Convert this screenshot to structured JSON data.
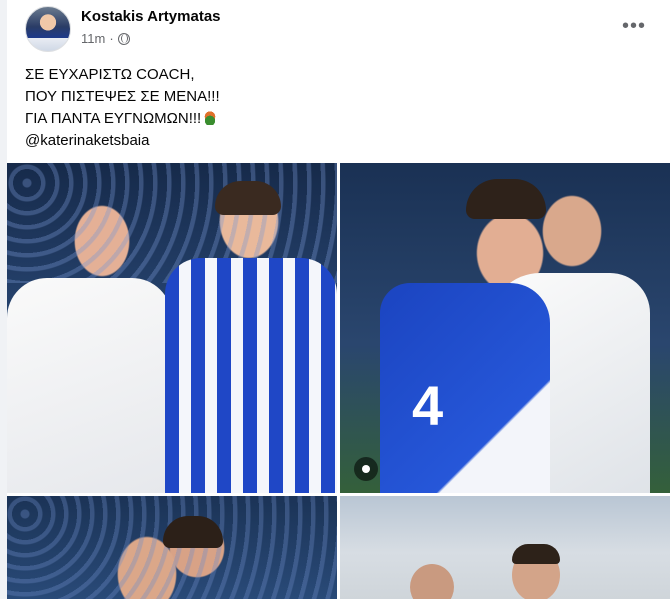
{
  "post": {
    "author": "Kostakis Artymatas",
    "time": "11m",
    "separator": "·",
    "audience_icon": "globe-icon",
    "more_label": "•••",
    "text_lines": [
      "ΣΕ ΕΥΧΑΡΙΣΤΩ COACH,",
      "ΠΟΥ ΠΙΣΤΕΨΕΣ ΣΕ ΜΕΝΑ!!!",
      "ΓΙΑ ΠΑΝΤΑ ΕΥΓΝΩΜΩΝ!!!",
      "@katerinaketsbaia"
    ],
    "emoji_icon": "emoji-icon",
    "jersey_number": "4"
  },
  "colors": {
    "author": "#050505",
    "meta": "#65676b",
    "background": "#f0f2f5"
  }
}
